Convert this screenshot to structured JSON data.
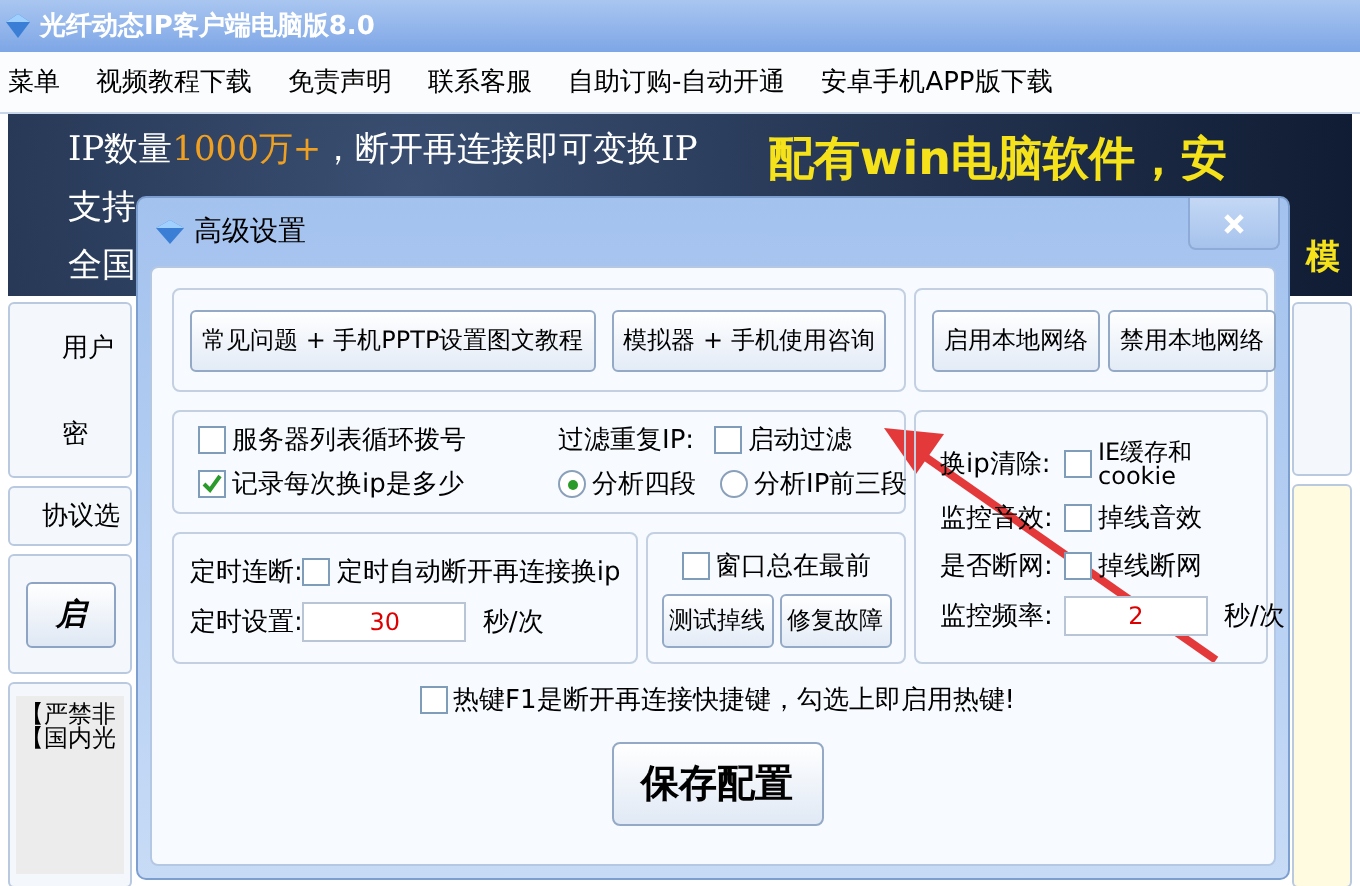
{
  "window": {
    "title": "光纤动态IP客户端电脑版8.0"
  },
  "menu": [
    {
      "label": "菜单"
    },
    {
      "label": "视频教程下载"
    },
    {
      "label": "免责声明"
    },
    {
      "label": "联系客服"
    },
    {
      "label": "自助订购-自动开通"
    },
    {
      "label": "安卓手机APP版下载"
    }
  ],
  "banner": {
    "lines": [
      [
        {
          "text": "IP数量",
          "highlight": false
        },
        {
          "text": "1000万+",
          "highlight": true
        },
        {
          "text": "，断开再连接即可变换IP",
          "highlight": false
        }
      ],
      [
        {
          "text": "支持",
          "highlight": false
        }
      ],
      [
        {
          "text": "全国",
          "highlight": false
        }
      ]
    ],
    "slogan": "配有win电脑软件，安",
    "slogan_2": "模"
  },
  "main_panel": {
    "labels": [
      "用户",
      "密"
    ],
    "protocol_label": "协议选",
    "start_button": "启",
    "notices": [
      "【严禁非",
      "【国内光"
    ]
  },
  "dialog": {
    "title": "高级设置",
    "help_buttons": [
      "常见问题 + 手机PPTP设置图文教程",
      "模拟器 + 手机使用咨询"
    ],
    "network_buttons": [
      "启用本地网络",
      "禁用本地网络"
    ],
    "options": [
      {
        "label": "服务器列表循环拨号",
        "checked": false
      },
      {
        "label": "记录每次换ip是多少",
        "checked": true
      }
    ],
    "filter": {
      "label": "过滤重复IP:",
      "option": "启动过滤",
      "checked": false,
      "radios": [
        {
          "label": "分析四段",
          "selected": true
        },
        {
          "label": "分析IP前三段",
          "selected": false
        }
      ]
    },
    "monitor": [
      {
        "label": "换ip清除:",
        "option": "IE缓存和cookie",
        "checked": false
      },
      {
        "label": "监控音效:",
        "option": "掉线音效",
        "checked": false
      },
      {
        "label": "是否断网:",
        "option": "掉线断网",
        "checked": false
      }
    ],
    "frequency": {
      "label": "监控频率:",
      "value": "2",
      "unit": "秒/次"
    },
    "timer": {
      "label": "定时连断:",
      "option": "定时自动断开再连接换ip",
      "checked": false,
      "setting_label": "定时设置:",
      "value": "30",
      "unit": "秒/次"
    },
    "on_top": {
      "label": "窗口总在最前",
      "checked": false
    },
    "tool_buttons": [
      "测试掉线",
      "修复故障"
    ],
    "hotkey": {
      "label": "热键F1是断开再连接快捷键，勾选上即启用热键!",
      "checked": false
    },
    "save_button": "保存配置"
  }
}
